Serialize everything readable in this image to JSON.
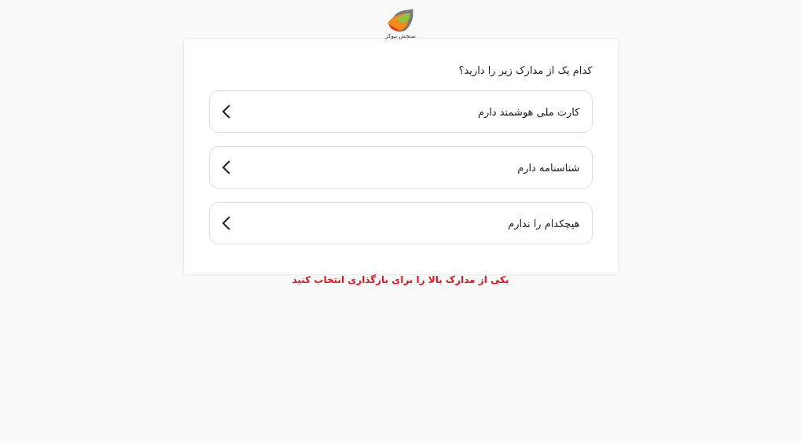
{
  "logo": {
    "caption": "سنجش بیوکر"
  },
  "question": "کدام یک از مدارک زیر را دارید؟",
  "options": [
    {
      "label": "کارت ملی هوشمند دارم"
    },
    {
      "label": "شناسنامه دارم"
    },
    {
      "label": "هیچکدام را ندارم"
    }
  ],
  "error": "یکی از مدارک بالا را برای بارگذاری انتخاب کنید"
}
